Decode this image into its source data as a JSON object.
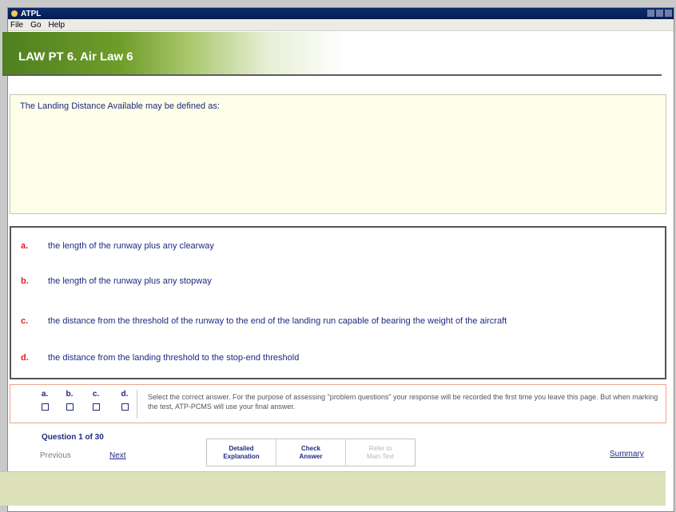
{
  "window": {
    "title": "ATPL"
  },
  "menu": [
    "File",
    "Go",
    "Help"
  ],
  "banner": {
    "title": "LAW PT  6. Air Law 6"
  },
  "question": {
    "text": "The Landing Distance Available may be defined as:"
  },
  "answers": [
    {
      "letter": "a.",
      "text": "the length of the runway plus any clearway"
    },
    {
      "letter": "b.",
      "text": "the length of the runway plus any stopway"
    },
    {
      "letter": "c.",
      "text": "the distance from the threshold of the runway to the end of the landing run capable of bearing the weight of the aircraft"
    },
    {
      "letter": "d.",
      "text": "the distance from the landing threshold to the stop-end threshold"
    }
  ],
  "selection": {
    "labels": [
      "a.",
      "b.",
      "c.",
      "d."
    ],
    "instructions": "Select the correct answer. For the purpose of assessing \"problem questions\" your response will be recorded the first time you leave this page. But when marking the test, ATP-PCMS will use your final answer."
  },
  "navigation": {
    "question_count": "Question 1 of 30",
    "previous": "Previous",
    "next": "Next",
    "summary": "Summary"
  },
  "buttons": [
    {
      "line1": "Detailed",
      "line2": "Explanation",
      "enabled": true
    },
    {
      "line1": "Check",
      "line2": "Answer",
      "enabled": true
    },
    {
      "line1": "Refer to",
      "line2": "Main Text",
      "enabled": false
    }
  ],
  "colors": {
    "banner_green": "#6f9d2a",
    "question_bg": "#fdfde8",
    "letter_red": "#e01e1e",
    "text_blue": "#1e2a80",
    "footer": "#dde1b9"
  }
}
